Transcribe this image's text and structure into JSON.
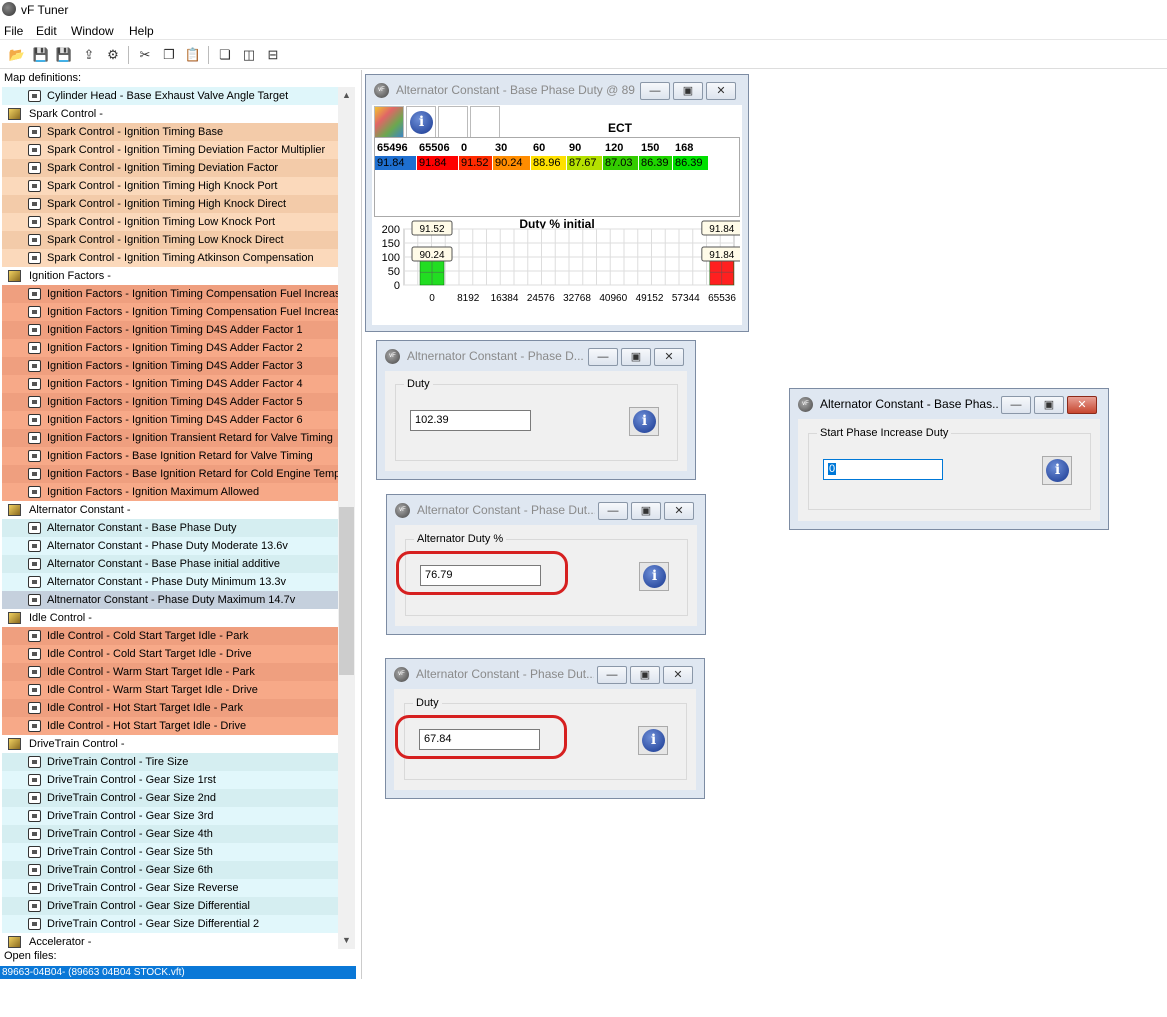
{
  "app": {
    "title": "vF Tuner"
  },
  "menu": [
    "File",
    "Edit",
    "Window",
    "Help"
  ],
  "left": {
    "label": "Map definitions:",
    "open_files_label": "Open files:",
    "open_file": "89663-04B04- (89663 04B04 STOCK.vft)",
    "rows": [
      {
        "t": "item",
        "text": "Cylinder Head - Base Exhaust Valve Angle Target",
        "bg": "#dff6fa"
      },
      {
        "t": "cat",
        "text": "Spark Control -",
        "bg": "#ffffff"
      },
      {
        "t": "item",
        "text": "Spark Control - Ignition Timing Base",
        "bg": "#f3cba9"
      },
      {
        "t": "item",
        "text": "Spark Control - Ignition Timing Deviation Factor Multiplier",
        "bg": "#fbd9bb"
      },
      {
        "t": "item",
        "text": "Spark Control - Ignition Timing Deviation Factor",
        "bg": "#f3cba9"
      },
      {
        "t": "item",
        "text": "Spark Control - Ignition Timing High Knock Port",
        "bg": "#fbd9bb"
      },
      {
        "t": "item",
        "text": "Spark Control - Ignition Timing High Knock Direct",
        "bg": "#f3cba9"
      },
      {
        "t": "item",
        "text": "Spark Control - Ignition Timing Low Knock Port",
        "bg": "#fbd9bb"
      },
      {
        "t": "item",
        "text": "Spark Control - Ignition Timing Low Knock Direct",
        "bg": "#f3cba9"
      },
      {
        "t": "item",
        "text": "Spark Control - Ignition Timing Atkinson Compensation",
        "bg": "#fbd9bb"
      },
      {
        "t": "cat",
        "text": "Ignition Factors -",
        "bg": "#ffffff"
      },
      {
        "t": "item",
        "text": "Ignition Factors - Ignition Timing Compensation Fuel Increase",
        "bg": "#ef9f7f"
      },
      {
        "t": "item",
        "text": "Ignition Factors - Ignition Timing Compensation Fuel Increase",
        "bg": "#f7a988"
      },
      {
        "t": "item",
        "text": "Ignition Factors - Ignition Timing D4S Adder Factor 1",
        "bg": "#ef9f7f"
      },
      {
        "t": "item",
        "text": "Ignition Factors - Ignition Timing D4S Adder Factor 2",
        "bg": "#f7a988"
      },
      {
        "t": "item",
        "text": "Ignition Factors - Ignition Timing D4S Adder Factor 3",
        "bg": "#ef9f7f"
      },
      {
        "t": "item",
        "text": "Ignition Factors - Ignition Timing D4S Adder Factor 4",
        "bg": "#f7a988"
      },
      {
        "t": "item",
        "text": "Ignition Factors - Ignition Timing D4S Adder Factor 5",
        "bg": "#ef9f7f"
      },
      {
        "t": "item",
        "text": "Ignition Factors - Ignition Timing D4S Adder Factor 6",
        "bg": "#f7a988"
      },
      {
        "t": "item",
        "text": "Ignition Factors - Ignition Transient Retard for Valve Timing",
        "bg": "#ef9f7f"
      },
      {
        "t": "item",
        "text": "Ignition Factors - Base Ignition Retard for Valve Timing",
        "bg": "#f7a988"
      },
      {
        "t": "item",
        "text": "Ignition Factors - Base Ignition Retard for Cold Engine Temp",
        "bg": "#ef9f7f"
      },
      {
        "t": "item",
        "text": "Ignition Factors - Ignition Maximum Allowed",
        "bg": "#f7a988"
      },
      {
        "t": "cat",
        "text": "Alternator Constant -",
        "bg": "#ffffff"
      },
      {
        "t": "item",
        "text": "Alternator Constant - Base Phase Duty",
        "bg": "#d5eef1"
      },
      {
        "t": "item",
        "text": "Alternator Constant - Phase Duty Moderate 13.6v",
        "bg": "#e1f7fb"
      },
      {
        "t": "item",
        "text": "Alternator Constant - Base Phase initial additive",
        "bg": "#d5eef1"
      },
      {
        "t": "item",
        "text": "Alternator Constant - Phase Duty Minimum 13.3v",
        "bg": "#e1f7fb"
      },
      {
        "t": "item",
        "text": "Altnernator Constant - Phase Duty Maximum 14.7v",
        "bg": "#c5d0dd"
      },
      {
        "t": "cat",
        "text": "Idle Control -",
        "bg": "#ffffff"
      },
      {
        "t": "item",
        "text": "Idle Control - Cold Start Target Idle - Park",
        "bg": "#ef9f7f"
      },
      {
        "t": "item",
        "text": "Idle Control - Cold Start Target Idle - Drive",
        "bg": "#f7a988"
      },
      {
        "t": "item",
        "text": "Idle Control - Warm Start Target Idle - Park",
        "bg": "#ef9f7f"
      },
      {
        "t": "item",
        "text": "Idle Control - Warm Start Target Idle - Drive",
        "bg": "#f7a988"
      },
      {
        "t": "item",
        "text": "Idle Control - Hot Start Target Idle - Park",
        "bg": "#ef9f7f"
      },
      {
        "t": "item",
        "text": "Idle Control - Hot Start Target Idle - Drive",
        "bg": "#f7a988"
      },
      {
        "t": "cat",
        "text": "DriveTrain Control -",
        "bg": "#ffffff"
      },
      {
        "t": "item",
        "text": "DriveTrain Control - Tire Size",
        "bg": "#d5eef1"
      },
      {
        "t": "item",
        "text": "DriveTrain Control - Gear Size 1rst",
        "bg": "#e1f7fb"
      },
      {
        "t": "item",
        "text": "DriveTrain Control - Gear Size 2nd",
        "bg": "#d5eef1"
      },
      {
        "t": "item",
        "text": "DriveTrain Control - Gear Size 3rd",
        "bg": "#e1f7fb"
      },
      {
        "t": "item",
        "text": "DriveTrain Control - Gear Size 4th",
        "bg": "#d5eef1"
      },
      {
        "t": "item",
        "text": "DriveTrain Control - Gear Size 5th",
        "bg": "#e1f7fb"
      },
      {
        "t": "item",
        "text": "DriveTrain Control - Gear Size 6th",
        "bg": "#d5eef1"
      },
      {
        "t": "item",
        "text": "DriveTrain Control - Gear Size Reverse",
        "bg": "#e1f7fb"
      },
      {
        "t": "item",
        "text": "DriveTrain Control - Gear Size Differential",
        "bg": "#d5eef1"
      },
      {
        "t": "item",
        "text": "DriveTrain Control - Gear Size Differential 2",
        "bg": "#e1f7fb"
      },
      {
        "t": "cat",
        "text": "Accelerator -",
        "bg": "#ffffff"
      }
    ]
  },
  "map_window": {
    "title": "Alternator Constant - Base Phase Duty @ 89...",
    "axis_title": "ECT",
    "columns": [
      "65496",
      "65506",
      "0",
      "30",
      "60",
      "90",
      "120",
      "150",
      "168"
    ],
    "values": [
      "91.84",
      "91.84",
      "91.52",
      "90.24",
      "88.96",
      "87.67",
      "87.03",
      "86.39",
      "86.39"
    ],
    "value_colors": [
      "#1e6fd0",
      "#ff0000",
      "#ff2a00",
      "#ff8c00",
      "#ffe000",
      "#b5e000",
      "#33cc00",
      "#1fd600",
      "#00e000"
    ],
    "chart_title": "Duty % initial"
  },
  "chart_data": {
    "type": "bar",
    "title": "Duty % initial",
    "x_ticks": [
      "0",
      "8192",
      "16384",
      "24576",
      "32768",
      "40960",
      "49152",
      "57344",
      "65536"
    ],
    "y_ticks": [
      "200",
      "150",
      "100",
      "50",
      "0"
    ],
    "ylim": [
      0,
      200
    ],
    "bars": [
      {
        "x": 0,
        "value": 91.52,
        "color": "#22dd22"
      },
      {
        "x": 30,
        "value": 90.24,
        "color": "#22dd22"
      },
      {
        "x": 65496,
        "value": 91.84,
        "color": "#ff2020"
      },
      {
        "x": 65506,
        "value": 91.84,
        "color": "#ff2020"
      }
    ],
    "labels": [
      "91.52",
      "90.24",
      "91.84",
      "91.84"
    ]
  },
  "win_duty1": {
    "title": "Altnernator Constant - Phase D...",
    "group": "Duty",
    "value": "102.39"
  },
  "win_start": {
    "title": "Alternator Constant - Base Phas...",
    "group": "Start Phase Increase Duty",
    "value": "0"
  },
  "win_duty2": {
    "title": "Alternator Constant - Phase Dut...",
    "group": "Alternator Duty %",
    "value": "76.79"
  },
  "win_duty3": {
    "title": "Alternator Constant - Phase Dut...",
    "group": "Duty",
    "value": "67.84"
  },
  "buttons": {
    "minimize": "—",
    "restore": "▣",
    "close": "✕"
  },
  "info_glyph": "i"
}
